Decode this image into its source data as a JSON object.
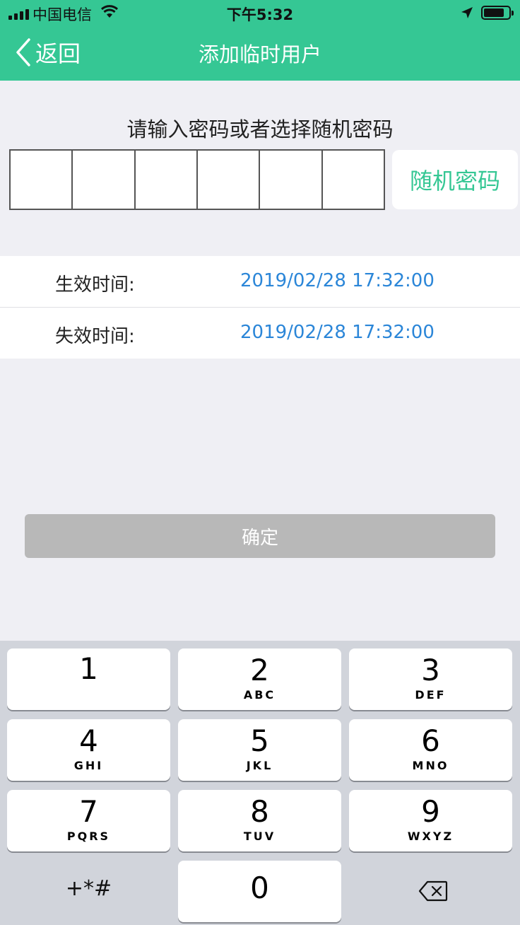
{
  "status_bar": {
    "carrier": "中国电信",
    "time": "下午5:32"
  },
  "nav": {
    "back_label": "返回",
    "title": "添加临时用户"
  },
  "password": {
    "prompt": "请输入密码或者选择随机密码",
    "digits": [
      "",
      "",
      "",
      "",
      "",
      ""
    ],
    "random_button": "随机密码"
  },
  "validity": {
    "start_label": "生效时间:",
    "start_value": "2019/02/28 17:32:00",
    "end_label": "失效时间:",
    "end_value": "2019/02/28 17:32:00"
  },
  "confirm_label": "确定",
  "keypad": {
    "keys": [
      {
        "digit": "1",
        "letters": ""
      },
      {
        "digit": "2",
        "letters": "ABC"
      },
      {
        "digit": "3",
        "letters": "DEF"
      },
      {
        "digit": "4",
        "letters": "GHI"
      },
      {
        "digit": "5",
        "letters": "JKL"
      },
      {
        "digit": "6",
        "letters": "MNO"
      },
      {
        "digit": "7",
        "letters": "PQRS"
      },
      {
        "digit": "8",
        "letters": "TUV"
      },
      {
        "digit": "9",
        "letters": "WXYZ"
      }
    ],
    "symbols_label": "+*#",
    "zero": "0"
  },
  "colors": {
    "brand": "#35c794",
    "link": "#2b86d8",
    "disabled_button": "#b8b8b8"
  }
}
